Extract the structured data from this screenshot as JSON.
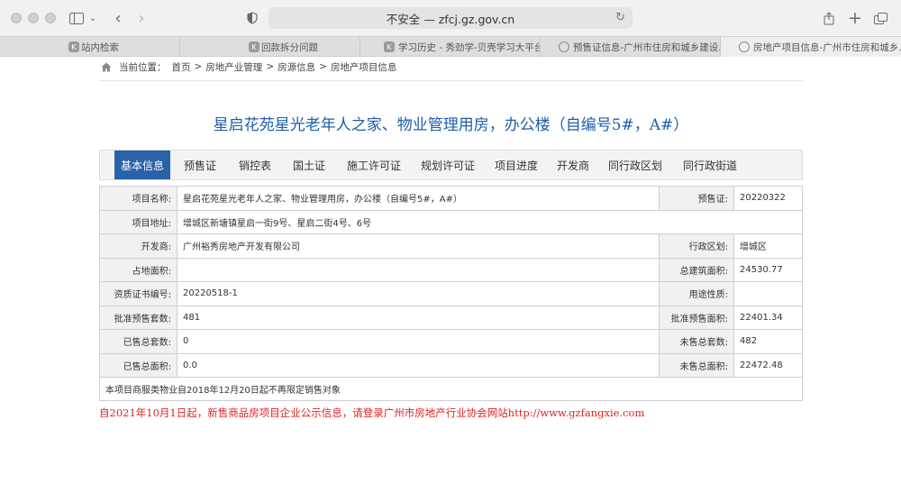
{
  "browser": {
    "address": "不安全 — zfcj.gz.gov.cn",
    "tabs": [
      {
        "label": "站内检索",
        "fav": "K"
      },
      {
        "label": "回款拆分问题",
        "fav": "K"
      },
      {
        "label": "学习历史 - 秀劲学-贝壳学习大平台",
        "fav": "K"
      },
      {
        "label": "预售证信息-广州市住房和城乡建设...",
        "fav": "globe"
      },
      {
        "label": "房地产项目信息-广州市住房和城乡...",
        "fav": "globe"
      }
    ]
  },
  "breadcrumb": {
    "prefix": "当前位置：",
    "items": [
      "首页",
      "房地产业管理",
      "房源信息",
      "房地产项目信息"
    ],
    "separator": ">"
  },
  "title": "星启花苑星光老年人之家、物业管理用房，办公楼（自编号5#，A#）",
  "nav": {
    "items": [
      "基本信息",
      "预售证",
      "销控表",
      "国土证",
      "施工许可证",
      "规划许可证",
      "项目进度",
      "开发商",
      "同行政区划",
      "同行政街道"
    ],
    "active_index": 0
  },
  "info": {
    "project_name_label": "项目名称:",
    "project_name": "星启花苑星光老年人之家、物业管理用房，办公楼（自编号5#，A#）",
    "presale_label": "预售证:",
    "presale": "20220322",
    "address_label": "项目地址:",
    "address": "增城区新塘镇星启一街9号、星启二街4号、6号",
    "developer_label": "开发商:",
    "developer": "广州裕秀房地产开发有限公司",
    "district_label": "行政区划:",
    "district": "增城区",
    "land_area_label": "占地面积:",
    "land_area": "",
    "gross_area_label": "总建筑面积:",
    "gross_area": "24530.77",
    "cert_no_label": "资质证书编号:",
    "cert_no": "20220518-1",
    "usage_label": "用途性质:",
    "usage": "",
    "approved_units_label": "批准预售套数:",
    "approved_units": "481",
    "approved_area_label": "批准预售面积:",
    "approved_area": "22401.34",
    "sold_units_label": "已售总套数:",
    "sold_units": "0",
    "unsold_units_label": "未售总套数:",
    "unsold_units": "482",
    "sold_area_label": "已售总面积:",
    "sold_area": "0.0",
    "unsold_area_label": "未售总面积:",
    "unsold_area": "22472.48",
    "note": "本项目商服类物业自2018年12月20日起不再限定销售对象"
  },
  "notice": "自2021年10月1日起，新售商品房项目企业公示信息，请登录广州市房地产行业协会网站http://www.gzfangxie.com"
}
